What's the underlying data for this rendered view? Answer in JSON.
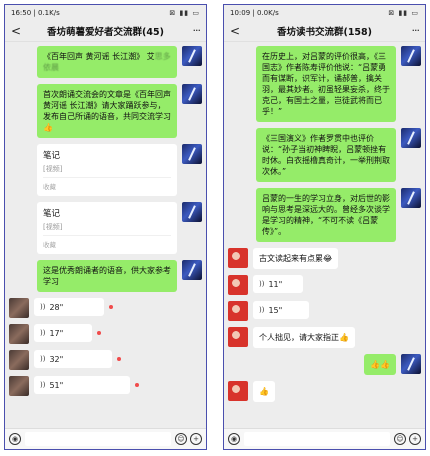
{
  "left_phone": {
    "status": {
      "time": "16:50",
      "speed": "0.1K/s",
      "icons": "⊠ ▮▮ ▭"
    },
    "nav": {
      "back": "<",
      "title": "香坊萌薯爱好者交流群(45)",
      "more": "···"
    },
    "messages": [
      {
        "kind": "text",
        "dir": "out",
        "text": "《百年回声 黄河谣 长江潮》 艾",
        "blur": "思多依晨"
      },
      {
        "kind": "text",
        "dir": "out",
        "text": "首次朗诵交流会的文章是《百年回声 黄河谣 长江潮》请大家踊跃参与，发布自己所诵的语音，共同交流学习👍"
      },
      {
        "kind": "card",
        "dir": "out",
        "title": "笔记",
        "sub": "[视频]",
        "foot": "收藏"
      },
      {
        "kind": "card",
        "dir": "out",
        "title": "笔记",
        "sub": "[视频]",
        "foot": "收藏"
      },
      {
        "kind": "text",
        "dir": "out",
        "text": "这是优秀朗诵者的语音，供大家参考学习"
      },
      {
        "kind": "voice",
        "dir": "in",
        "wave": "))",
        "duration": "28\""
      },
      {
        "kind": "voice",
        "dir": "in",
        "wave": "))",
        "duration": "17\""
      },
      {
        "kind": "voice",
        "dir": "in",
        "wave": "))",
        "duration": "32\""
      },
      {
        "kind": "voice",
        "dir": "in",
        "wave": "))",
        "duration": "51\""
      }
    ]
  },
  "right_phone": {
    "status": {
      "time": "10:09",
      "speed": "0.0K/s",
      "icons": "⊠ ▮▮ ▭"
    },
    "nav": {
      "back": "<",
      "title": "香坊读书交流群(158)",
      "more": "···"
    },
    "messages": [
      {
        "kind": "text",
        "dir": "out",
        "text": "在历史上，对吕蒙的评价很高，《三国志》作者陈寿评价他说：“吕蒙勇而有谋断，识军计，谲郝普，擒关羽，最其妙者。初虽轻果妄杀，终于克己，有国士之量，岂徒武将而已乎！”"
      },
      {
        "kind": "text",
        "dir": "out",
        "text": "《三国演义》作者罗贯中也评价说：“孙子当初神睥睨，吕蒙顿挫有时休。白衣摇橹真奇计，一举刑荆取次休。”"
      },
      {
        "kind": "text",
        "dir": "out",
        "text": "吕蒙的一生的学习立身，对后世的影响与思考是深远大的。曾经多次谈学是学习的精神，“不可不读《吕蒙传》”。"
      },
      {
        "kind": "text",
        "dir": "in",
        "text": "古文读起来有点累😂"
      },
      {
        "kind": "voice",
        "dir": "in",
        "wave": "))",
        "duration": "11\""
      },
      {
        "kind": "voice",
        "dir": "in",
        "wave": "))",
        "duration": "15\""
      },
      {
        "kind": "text",
        "dir": "in",
        "text": "个人拙见，请大家指正👍"
      },
      {
        "kind": "text",
        "dir": "out",
        "text": "👍👍"
      },
      {
        "kind": "text",
        "dir": "in",
        "text": "👍"
      }
    ]
  },
  "input_bar": {
    "voice_icon": "◉",
    "emoji_icon": "☺",
    "plus_icon": "+"
  }
}
